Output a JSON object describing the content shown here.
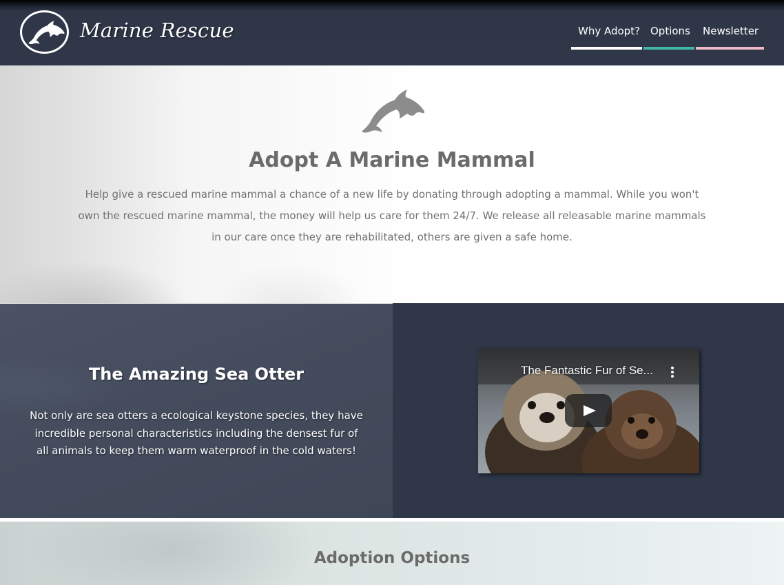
{
  "header": {
    "brand": "Marine Rescue",
    "logo_icon": "dolphin-icon",
    "nav": [
      {
        "label": "Why Adopt?",
        "underline_color": "#ffffff"
      },
      {
        "label": "Options",
        "underline_color": "#3fb8a4"
      },
      {
        "label": "Newsletter",
        "underline_color": "#f1b9c8"
      }
    ]
  },
  "intro": {
    "icon": "dolphin-icon",
    "title": "Adopt A Marine Mammal",
    "text": "Help give a rescued marine mammal a chance of a new life by donating through adopting a mammal. While you won't own the rescued marine mammal, the money will help us care for them 24/7. We release all releasable marine mammals in our care once they are rehabilitated, others are given a safe home."
  },
  "otter": {
    "title": "The Amazing Sea Otter",
    "text": "Not only are sea otters a ecological keystone species, they have incredible personal characteristics including the densest fur of all animals to keep them warm waterproof in the cold waters!"
  },
  "video": {
    "title": "The Fantastic Fur of Se...",
    "play_icon": "play-icon",
    "menu_icon": "more-vertical-icon"
  },
  "adoption": {
    "title": "Adoption Options"
  },
  "colors": {
    "header_bg": "#2f3749",
    "nav_why": "#ffffff",
    "nav_options": "#3fb8a4",
    "nav_newsletter": "#f1b9c8",
    "section_dark": "#2f3749"
  }
}
